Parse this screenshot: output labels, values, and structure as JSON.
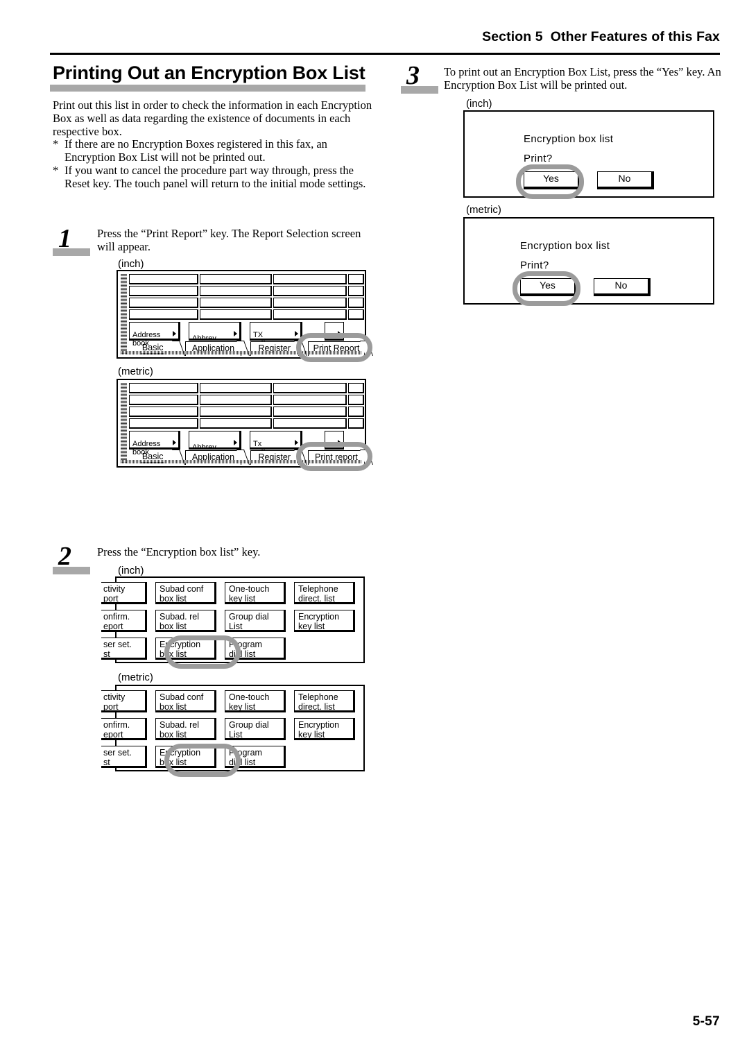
{
  "header": {
    "section_text": "Section 5  Other Features of this Fax"
  },
  "title": "Printing Out an Encryption Box List",
  "intro": {
    "paragraph": "Print out this list in order to check the information in each Encryption Box as well as data regarding the existence of documents in each respective box.",
    "bullet_marker": "*",
    "bullets": [
      "If there are no Encryption Boxes registered in this fax, an Encryption Box List will not be printed out.",
      "If you want to cancel the procedure part way through, press the Reset key. The touch panel will return to the initial mode settings."
    ]
  },
  "steps": [
    {
      "number": "1",
      "text": "Press the “Print Report” key. The Report Selection screen will appear."
    },
    {
      "number": "2",
      "text": "Press the “Encryption box list” key."
    },
    {
      "number": "3",
      "text": "To print out an Encryption Box List, press the “Yes” key. An Encryption Box List will be printed out."
    }
  ],
  "unit_labels": {
    "inch": "(inch)",
    "metric": "(metric)"
  },
  "basic_screen_inch": {
    "function_keys": [
      "Address\nbook",
      "Abbrev.",
      "TX\nsetting"
    ],
    "more_dots": "···",
    "tabs": [
      "Basic",
      "Application",
      "Register",
      "Print Report"
    ],
    "highlighted_tab": "Print Report"
  },
  "basic_screen_metric": {
    "function_keys": [
      "Address\nbook",
      "Abbrev.",
      "Tx\nsetting"
    ],
    "more_dots": "···",
    "tabs": [
      "Basic",
      "Application",
      "Register",
      "Print report"
    ],
    "highlighted_tab": "Print report"
  },
  "report_screen_inch": {
    "rows": [
      [
        "ctivity\nport",
        "Subad conf\nbox list",
        "One-touch\nkey list",
        "Telephone\ndirect. list"
      ],
      [
        "onfirm.\neport",
        "Subad. rel\nbox list",
        "Group dial\nList",
        "Encryption\nkey list"
      ],
      [
        "ser set.\nst",
        "Encryption\nbox list",
        "Program\ndial list",
        ""
      ]
    ],
    "highlighted_key": "Encryption\nbox list"
  },
  "report_screen_metric": {
    "rows": [
      [
        "ctivity\nport",
        "Subad conf\nbox list",
        "One-touch\nkey list",
        "Telephone\ndirect. list"
      ],
      [
        "onfirm.\neport",
        "Subad. rel\nbox list",
        "Group dial\nList",
        "Encryption\nkey list"
      ],
      [
        "ser set.\nst",
        "Encryption\nbox list",
        "Program\ndial list",
        ""
      ]
    ],
    "highlighted_key": "Encryption\nbox list"
  },
  "confirm_screen_inch": {
    "list_name": "Encryption box list",
    "question": "Print?",
    "yes_label": "Yes",
    "no_label": "No",
    "highlighted_button": "Yes"
  },
  "confirm_screen_metric": {
    "list_name": "Encryption box list",
    "question": "Print?",
    "yes_label": "Yes",
    "no_label": "No",
    "highlighted_button": "Yes"
  },
  "colors": {
    "accent_gray": "#a8a8a8",
    "highlight_ring": "#9b9b9b"
  },
  "page_number": "5-57"
}
